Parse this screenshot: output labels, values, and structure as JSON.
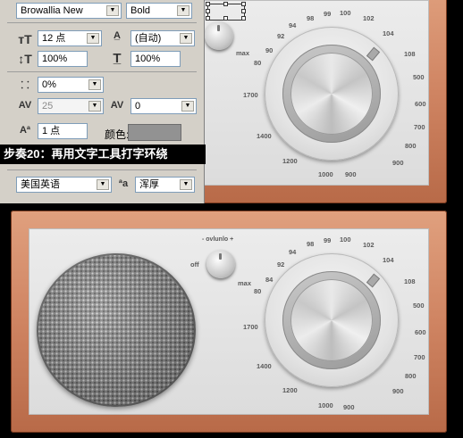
{
  "character_panel": {
    "font_family": "Browallia New",
    "font_style": "Bold",
    "font_size": "12 点",
    "leading": "(自动)",
    "vertical_scale": "100%",
    "horizontal_scale": "100%",
    "tsume": "0%",
    "kerning": "25",
    "tracking": "0",
    "baseline_shift": "1 点",
    "color_label": "颜色:",
    "color_value": "#929292",
    "language": "美国英语",
    "anti_alias": "浑厚",
    "icons": [
      "font-size-icon",
      "leading-icon",
      "vertical-scale-icon",
      "horizontal-scale-icon",
      "tsume-icon",
      "kerning-icon",
      "tracking-icon",
      "baseline-shift-icon",
      "anti-alias-icon"
    ]
  },
  "step_caption": "步奏20：再用文字工具打字环绕",
  "radio_top": {
    "volume_label": "max",
    "scale_numbers": [
      "94",
      "98",
      "99",
      "100",
      "102",
      "104",
      "108",
      "500",
      "600",
      "700",
      "800",
      "900",
      "1000",
      "1200",
      "1400",
      "1700",
      "80",
      "90",
      "92"
    ]
  },
  "radio_bottom": {
    "volume_header": "- ovlunlo +",
    "off_label": "off",
    "max_label": "max",
    "scale_numbers": [
      "94",
      "98",
      "99",
      "100",
      "102",
      "104",
      "108",
      "500",
      "600",
      "700",
      "800",
      "900",
      "1000",
      "1200",
      "1400",
      "1700",
      "80",
      "84",
      "90",
      "92"
    ]
  }
}
